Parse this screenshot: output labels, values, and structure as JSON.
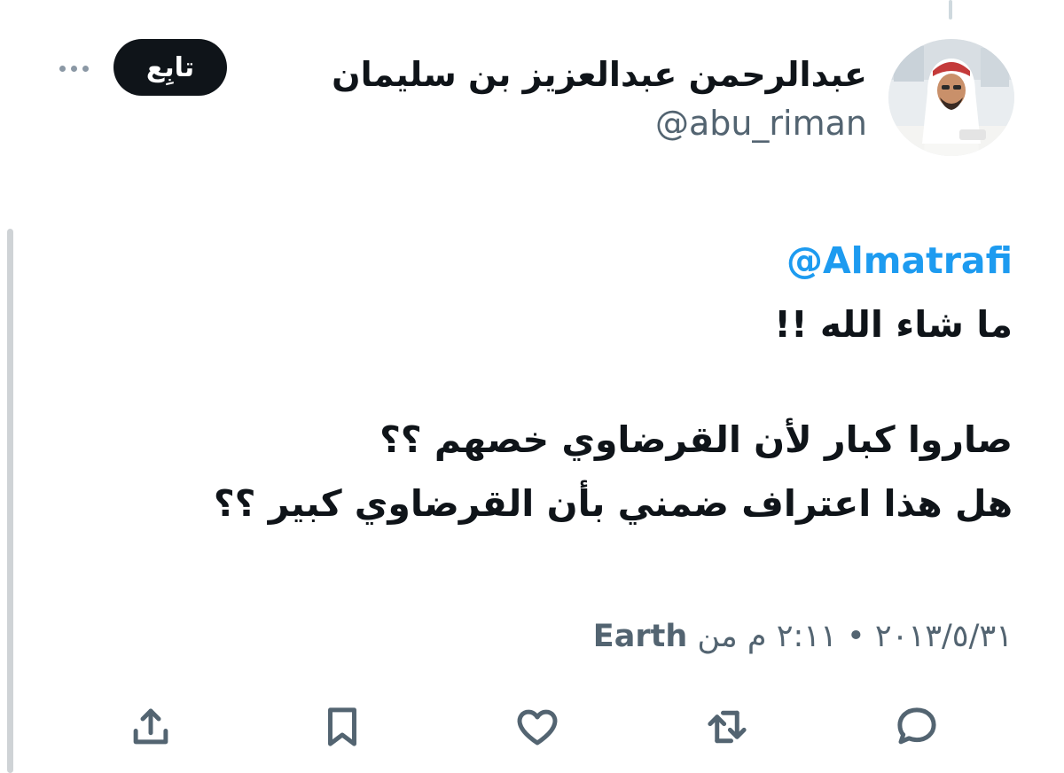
{
  "profile": {
    "display_name": "عبدالرحمن عبدالعزيز بن سليمان",
    "handle": "@abu_riman",
    "follow_label": "تابِع"
  },
  "tweet": {
    "mention": "@Almatrafi",
    "line1": "ما شاء الله !!",
    "line2": "صاروا كبار لأن القرضاوي خصهم ؟؟",
    "line3": "هل هذا اعتراف ضمني بأن القرضاوي كبير ؟؟"
  },
  "meta": {
    "datetime": "٢٠١٣/٥/٣١ • ٢:١١ م",
    "from_label": "من",
    "source": "Earth"
  },
  "actions": {
    "icons": [
      "reply-icon",
      "retweet-icon",
      "like-icon",
      "bookmark-icon",
      "share-icon"
    ]
  },
  "colors": {
    "mention": "#1d9bf0",
    "secondary_text": "#536471",
    "follow_button_bg": "#0f1419"
  }
}
